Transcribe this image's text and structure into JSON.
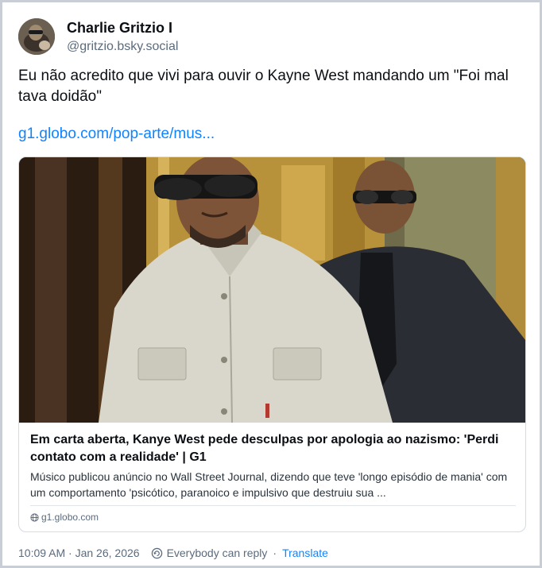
{
  "author": {
    "display_name": "Charlie Gritzio I",
    "handle": "@gritzio.bsky.social"
  },
  "post": {
    "text": "Eu não acredito que vivi para ouvir o Kayne West mandando um \"Foi mal tava doidão\"",
    "link_text": "g1.globo.com/pop-arte/mus..."
  },
  "embed": {
    "title": "Em carta aberta, Kanye West pede desculpas por apologia ao nazismo: 'Perdi contato com a realidade' | G1",
    "description": "Músico publicou anúncio no Wall Street Journal, dizendo que teve 'longo episódio de mania' com um comportamento 'psicótico, paranoico e impulsivo que destruiu sua ...",
    "domain": "g1.globo.com"
  },
  "meta": {
    "timestamp": "10:09 AM · Jan 26, 2026",
    "reply_setting": "Everybody can reply",
    "separator": "·",
    "translate_label": "Translate"
  },
  "colors": {
    "link": "#1083fe",
    "muted": "#5b6b7c",
    "border": "#d4dbe2"
  },
  "icons": [
    "avatar-image",
    "globe-icon",
    "reply-restriction-icon"
  ]
}
